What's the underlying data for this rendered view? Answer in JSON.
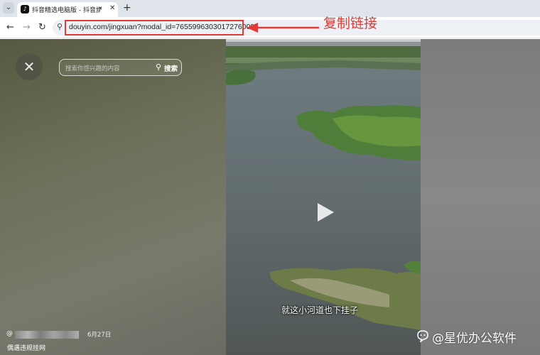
{
  "browser": {
    "tab": {
      "title": "抖音精选电脑版 - 抖音旗下",
      "audio_icon": "speaker-icon",
      "close_icon": "close-icon"
    },
    "new_tab_icon": "plus-icon",
    "address": {
      "url": "douyin.com/jingxuan?modal_id=7655996303017276009"
    }
  },
  "annotation": {
    "label": "复制链接",
    "color": "#e53935"
  },
  "page": {
    "search": {
      "placeholder": "搜索你感兴趣的内容",
      "button_label": "搜索"
    },
    "video": {
      "subtitle": "就这小河道也下挂子",
      "author_prefix": "@",
      "date": "6月27日",
      "caption": "偶遇违规挂网"
    }
  },
  "watermark": {
    "text": "@星优办公软件"
  }
}
